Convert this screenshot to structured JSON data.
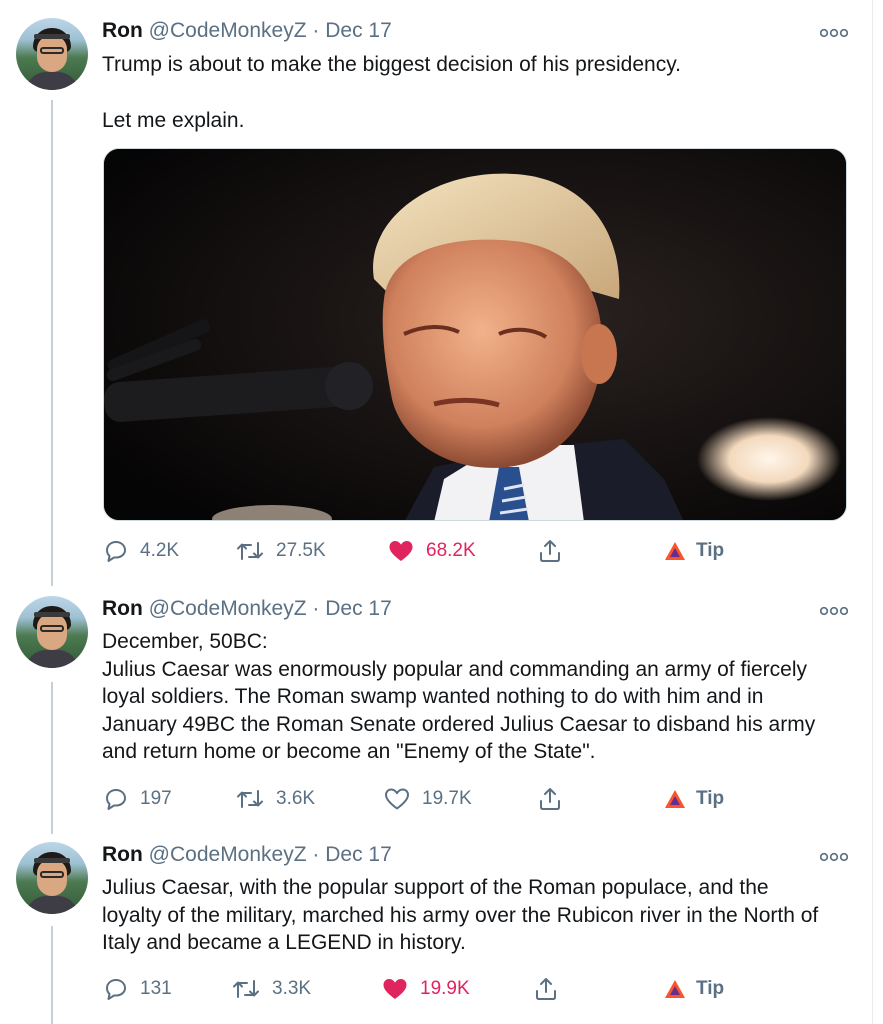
{
  "thread": {
    "tweets": [
      {
        "name": "Ron",
        "handle": "@CodeMonkeyZ",
        "separator": "·",
        "date": "Dec 17",
        "paragraphs": [
          "Trump is about to make the biggest decision of his presidency.",
          "Let me explain."
        ],
        "media": {
          "alt": "Photo of Trump standing behind a microphone"
        },
        "stats": {
          "replies": "4.2K",
          "retweets": "27.5K",
          "likes": "68.2K",
          "liked": true
        },
        "tip_label": "Tip"
      },
      {
        "name": "Ron",
        "handle": "@CodeMonkeyZ",
        "separator": "·",
        "date": "Dec 17",
        "paragraphs": [
          "December, 50BC:",
          "Julius Caesar was enormously popular and commanding an army of fiercely loyal soldiers. The Roman swamp wanted nothing to do with him and in January 49BC the Roman Senate ordered Julius Caesar to disband his army and return home or become an \"Enemy of the State\"."
        ],
        "stats": {
          "replies": "197",
          "retweets": "3.6K",
          "likes": "19.7K",
          "liked": false
        },
        "tip_label": "Tip"
      },
      {
        "name": "Ron",
        "handle": "@CodeMonkeyZ",
        "separator": "·",
        "date": "Dec 17",
        "paragraphs": [
          "Julius Caesar, with the popular support of the Roman populace, and the loyalty of the military, marched his army over the Rubicon river in the North of Italy and became a LEGEND in history."
        ],
        "stats": {
          "replies": "131",
          "retweets": "3.3K",
          "likes": "19.9K",
          "liked": true
        },
        "tip_label": "Tip"
      }
    ]
  },
  "colors": {
    "text": "#14171a",
    "secondary": "#5b7083",
    "like": "#e0245e",
    "thread_line": "#c4cfd6",
    "tip_brand_orange": "#fb542b",
    "tip_brand_purple": "#662d91"
  },
  "icons": {
    "more": "more-options-icon",
    "reply": "reply-icon",
    "retweet": "retweet-icon",
    "like_filled": "heart-filled-icon",
    "like_outline": "heart-outline-icon",
    "share": "share-icon",
    "tip": "brave-tip-icon"
  }
}
